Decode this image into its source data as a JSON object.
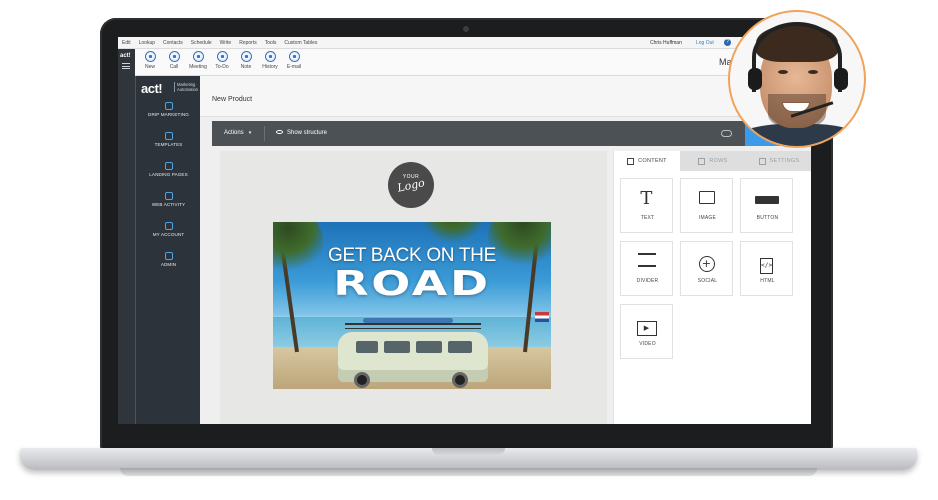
{
  "menu": [
    "Edit",
    "Lookup",
    "Contacts",
    "Schedule",
    "Write",
    "Reports",
    "Tools",
    "Custom Tables"
  ],
  "user_name": "Chris Huffman",
  "logout_label": "Log Out",
  "help_label": "?",
  "toolbar": {
    "items": [
      {
        "label": "New",
        "icon": "new-icon"
      },
      {
        "label": "Call",
        "icon": "phone-icon"
      },
      {
        "label": "Meeting",
        "icon": "meeting-icon"
      },
      {
        "label": "To-Do",
        "icon": "todo-icon"
      },
      {
        "label": "Note",
        "icon": "note-icon"
      },
      {
        "label": "History",
        "icon": "history-icon"
      },
      {
        "label": "E-mail",
        "icon": "email-icon"
      }
    ],
    "title_fragment": "Ma"
  },
  "left_strip": {
    "logo": "act!"
  },
  "sidebar": {
    "brand": "act!",
    "brand_sub_1": "Marketing",
    "brand_sub_2": "Automation",
    "items": [
      {
        "label": "DRIP MARKETING",
        "icon": "drip-icon"
      },
      {
        "label": "TEMPLATES",
        "icon": "templates-icon"
      },
      {
        "label": "LANDING PAGES",
        "icon": "landing-pages-icon"
      },
      {
        "label": "WEB ACTIVITY",
        "icon": "web-activity-icon"
      },
      {
        "label": "MY ACCOUNT",
        "icon": "account-icon"
      },
      {
        "label": "ADMIN",
        "icon": "admin-icon"
      }
    ]
  },
  "page_title": "New Product",
  "actionbar": {
    "actions_label": "Actions",
    "show_structure_label": "Show structure"
  },
  "email": {
    "logo_top": "YOUR",
    "logo_main": "Logo",
    "headline_1": "GET BACK ON THE",
    "headline_2": "ROAD"
  },
  "panel": {
    "tabs": [
      {
        "label": "CONTENT",
        "active": true
      },
      {
        "label": "ROWS",
        "active": false
      },
      {
        "label": "SETTINGS",
        "active": false
      }
    ],
    "tiles": [
      {
        "label": "TEXT",
        "icon": "text-icon"
      },
      {
        "label": "IMAGE",
        "icon": "image-icon"
      },
      {
        "label": "BUTTON",
        "icon": "button-icon"
      },
      {
        "label": "DIVIDER",
        "icon": "divider-icon"
      },
      {
        "label": "SOCIAL",
        "icon": "social-icon"
      },
      {
        "label": "HTML",
        "icon": "html-icon"
      },
      {
        "label": "VIDEO",
        "icon": "video-icon"
      }
    ]
  },
  "colors": {
    "accent": "#3b9be8",
    "sidebar_bg": "#2c333a",
    "avatar_ring": "#f0a35a"
  }
}
